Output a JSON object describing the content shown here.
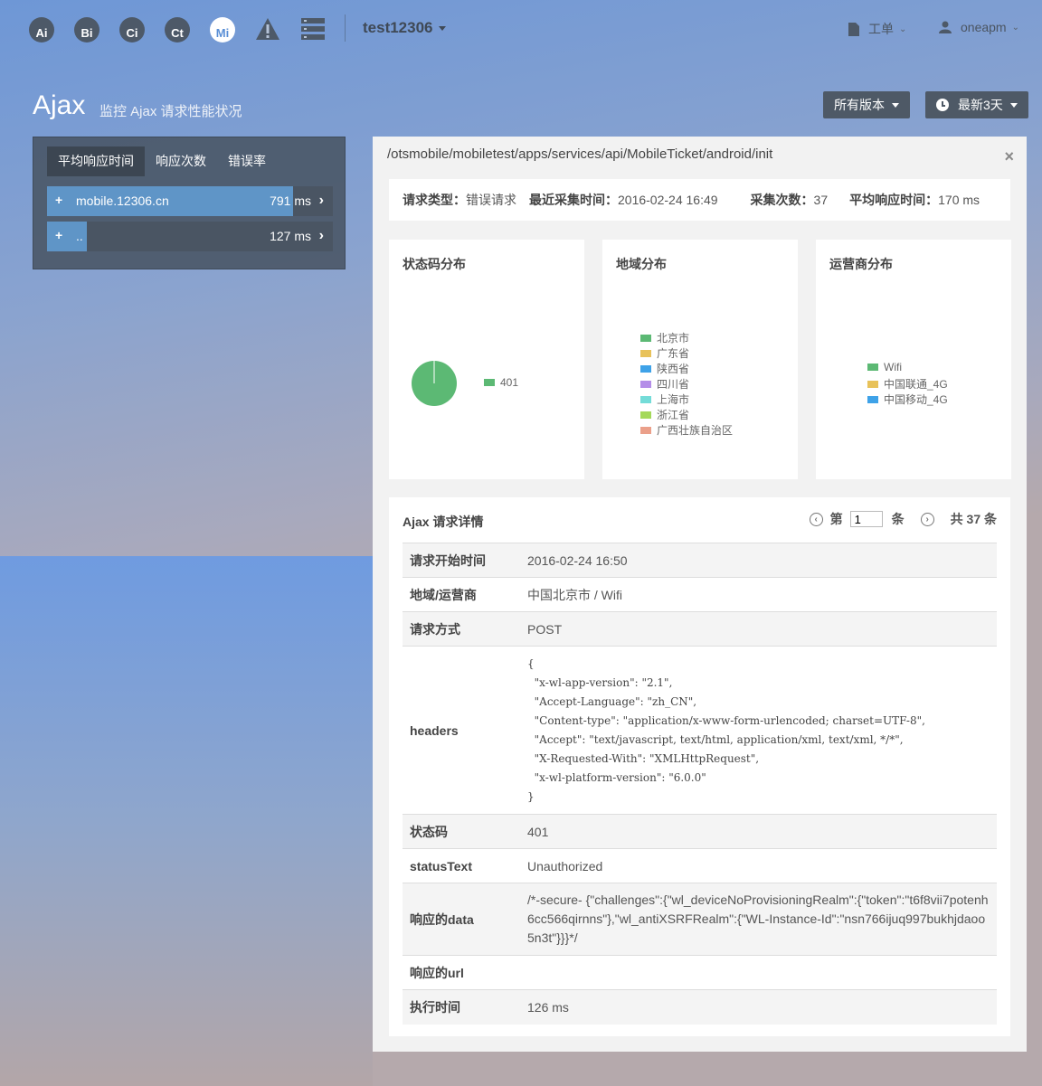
{
  "nav": {
    "icons": [
      {
        "label": "Ai",
        "name": "ai-app-icon"
      },
      {
        "label": "Bi",
        "name": "bi-app-icon"
      },
      {
        "label": "Ci",
        "name": "ci-app-icon"
      },
      {
        "label": "Ct",
        "name": "ct-app-icon"
      },
      {
        "label": "Mi",
        "name": "mi-app-icon"
      }
    ],
    "app_name": "test12306",
    "workorder": "工单",
    "user": "oneapm"
  },
  "header": {
    "title": "Ajax",
    "subtitle": "监控 Ajax 请求性能状况",
    "version_btn": "所有版本",
    "time_btn": "最新3天"
  },
  "left": {
    "tabs": [
      "平均响应时间",
      "响应次数",
      "错误率"
    ],
    "rows": [
      {
        "plus": "+",
        "name": "mobile.12306.cn",
        "value": "791 ms",
        "fill": 0.86
      },
      {
        "plus": "+",
        "name": "..",
        "value": "127 ms",
        "fill": 0.14
      }
    ]
  },
  "detail": {
    "url": "/otsmobile/mobiletest/apps/services/api/MobileTicket/android/init",
    "close": "×",
    "summary": {
      "type_label": "请求类型：",
      "type_value": "错误请求",
      "last_label": "最近采集时间：",
      "last_value": "2016-02-24 16:49",
      "count_label": "采集次数：",
      "count_value": "37",
      "avg_label": "平均响应时间：",
      "avg_value": "170 ms"
    },
    "cards": {
      "status": {
        "title": "状态码分布",
        "legend": [
          {
            "label": "401",
            "color": "#5cb974"
          }
        ]
      },
      "region": {
        "title": "地域分布",
        "legend": [
          {
            "label": "北京市",
            "color": "#5cb974"
          },
          {
            "label": "广东省",
            "color": "#e8c25a"
          },
          {
            "label": "陕西省",
            "color": "#3ea2e8"
          },
          {
            "label": "四川省",
            "color": "#b48ee8"
          },
          {
            "label": "上海市",
            "color": "#74dcd8"
          },
          {
            "label": "浙江省",
            "color": "#a4d95a"
          },
          {
            "label": "广西壮族自治区",
            "color": "#eba08a"
          }
        ]
      },
      "carrier": {
        "title": "运营商分布",
        "legend": [
          {
            "label": "Wifi",
            "color": "#5cb974"
          },
          {
            "label": "中国联通_4G",
            "color": "#e8c25a"
          },
          {
            "label": "中国移动_4G",
            "color": "#3ea2e8"
          }
        ]
      }
    },
    "requests": {
      "title": "Ajax 请求详情",
      "pager": {
        "prefix": "第",
        "current": "1",
        "suffix": "条",
        "total": "共 37 条"
      },
      "rows": {
        "start_time": {
          "key": "请求开始时间",
          "value": "2016-02-24 16:50"
        },
        "region": {
          "key": "地域/运营商",
          "value": "中国北京市 / Wifi"
        },
        "method": {
          "key": "请求方式",
          "value": "POST"
        },
        "headers": {
          "key": "headers",
          "value": "{\n  \"x-wl-app-version\": \"2.1\",\n  \"Accept-Language\": \"zh_CN\",\n  \"Content-type\": \"application/x-www-form-urlencoded; charset=UTF-8\",\n  \"Accept\": \"text/javascript, text/html, application/xml, text/xml, */*\",\n  \"X-Requested-With\": \"XMLHttpRequest\",\n  \"x-wl-platform-version\": \"6.0.0\"\n}"
        },
        "status": {
          "key": "状态码",
          "value": "401"
        },
        "status_text": {
          "key": "statusText",
          "value": "Unauthorized"
        },
        "data": {
          "key": "响应的data",
          "value": "/*-secure- {\"challenges\":{\"wl_deviceNoProvisioningRealm\":{\"token\":\"t6f8vii7potenh6cc566qirnns\"},\"wl_antiXSRFRealm\":{\"WL-Instance-Id\":\"nsn766ijuq997bukhjdaoo5n3t\"}}}*/"
        },
        "url": {
          "key": "响应的url",
          "value": ""
        },
        "exec_time": {
          "key": "执行时间",
          "value": "126 ms"
        }
      }
    }
  }
}
